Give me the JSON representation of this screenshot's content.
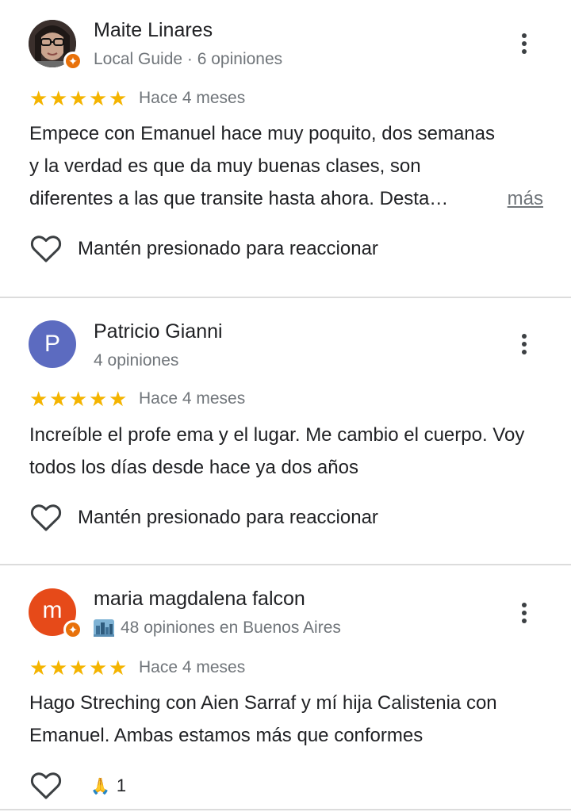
{
  "reviews": [
    {
      "name": "Maite Linares",
      "meta": "Local Guide · 6 opiniones",
      "stars": 5,
      "time": "Hace 4 meses",
      "text": "Empece con Emanuel hace muy poquito, dos semanas y la verdad es que da muy buenas clases, son diferentes a las que transite hasta ahora. Desta…",
      "more": "más",
      "reaction_label": "Mantén presionado para reaccionar",
      "avatar_type": "photo"
    },
    {
      "name": "Patricio Gianni",
      "avatar_letter": "P",
      "avatar_color": "#5c6bc0",
      "meta": "4 opiniones",
      "stars": 5,
      "time": "Hace 4 meses",
      "text": "Increíble el profe ema y el lugar. Me cambio el cuerpo. Voy todos los días desde hace ya dos años",
      "reaction_label": "Mantén presionado para reaccionar"
    },
    {
      "name": "maria magdalena falcon",
      "avatar_letter": "m",
      "avatar_color": "#e64a19",
      "meta": "48 opiniones en Buenos Aires",
      "meta_icon": "city-icon",
      "stars": 5,
      "time": "Hace 4 meses",
      "text": "Hago Streching con Aien Sarraf y mí hija Calistenia con Emanuel. Ambas estamos más que conformes",
      "reaction_emoji": "🙏",
      "reaction_count": "1"
    }
  ],
  "star_glyph": "★",
  "colors": {
    "star": "#f4b400",
    "badge": "#e8710a",
    "muted": "#70757a"
  }
}
